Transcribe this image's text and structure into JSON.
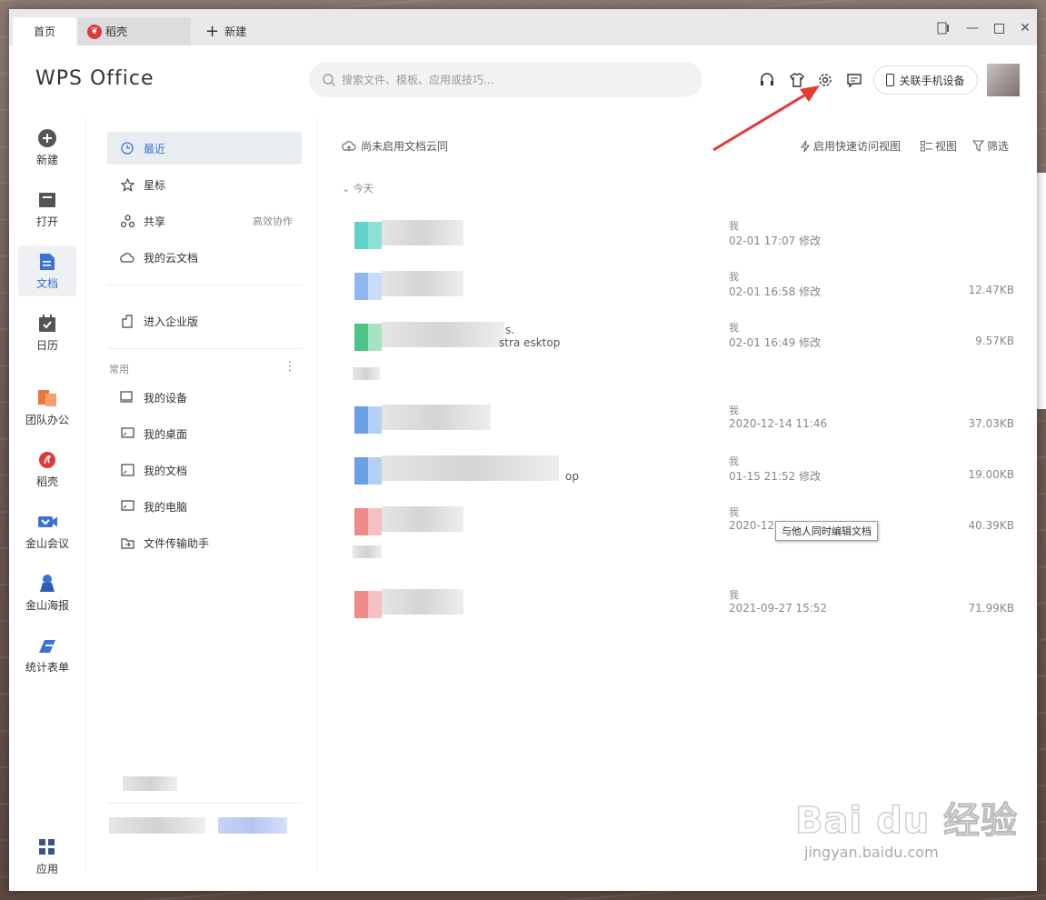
{
  "window": {
    "tabs": [
      {
        "label": "首页"
      },
      {
        "label": "稻壳"
      },
      {
        "label": "新建"
      }
    ]
  },
  "header": {
    "logo": "WPS Office",
    "search_placeholder": "搜索文件、模板、应用或技巧...",
    "phone_button": "关联手机设备"
  },
  "rail": {
    "items": [
      {
        "label": "新建",
        "icon": "plus-circle-icon"
      },
      {
        "label": "打开",
        "icon": "folder-icon"
      },
      {
        "label": "文档",
        "icon": "document-icon"
      },
      {
        "label": "日历",
        "icon": "calendar-icon"
      },
      {
        "label": "团队办公",
        "icon": "team-icon"
      },
      {
        "label": "稻壳",
        "icon": "docer-icon"
      },
      {
        "label": "金山会议",
        "icon": "meeting-icon"
      },
      {
        "label": "金山海报",
        "icon": "poster-icon"
      },
      {
        "label": "统计表单",
        "icon": "form-icon"
      },
      {
        "label": "应用",
        "icon": "apps-icon"
      }
    ]
  },
  "nav": {
    "recent": "最近",
    "starred": "星标",
    "shared": "共享",
    "shared_extra": "高效协作",
    "cloud": "我的云文档",
    "enterprise": "进入企业版",
    "section_common": "常用",
    "section_more": "⋮",
    "common_items": [
      {
        "label": "我的设备"
      },
      {
        "label": "我的桌面"
      },
      {
        "label": "我的文档"
      },
      {
        "label": "我的电脑"
      },
      {
        "label": "文件传输助手"
      }
    ]
  },
  "main": {
    "cloud_note": "尚未启用文档云同",
    "quick_access": "启用快速访问视图",
    "view": "视图",
    "filter": "筛选",
    "group_label": "今天",
    "files": [
      {
        "owner": "我",
        "time": "02-01 17:07 修改",
        "size": "",
        "name_fragment": "",
        "color": "#5fd3c7"
      },
      {
        "owner": "我",
        "time": "02-01 16:58 修改",
        "size": "12.47KB",
        "name_fragment": "",
        "color": "#8fb7f0"
      },
      {
        "owner": "我",
        "time": "02-01 16:49 修改",
        "size": "9.57KB",
        "name_fragment": "s.",
        "path_fragment": "stra   esktop",
        "color": "#4cc487"
      },
      {
        "owner": "我",
        "time": "2020-12-14 11:46",
        "size": "37.03KB",
        "name_fragment": "",
        "color": "#6b9fe6"
      },
      {
        "owner": "我",
        "time": "01-15 21:52 修改",
        "size": "19.00KB",
        "name_fragment": "",
        "path_fragment": "op",
        "color": "#6b9fe6"
      },
      {
        "owner": "我",
        "time": "2020-12-",
        "size": "40.39KB",
        "name_fragment": "",
        "color": "#ef8a8a"
      },
      {
        "owner": "我",
        "time": "2021-09-27 15:52",
        "size": "71.99KB",
        "name_fragment": "",
        "color": "#ef8a8a"
      }
    ],
    "tooltip": "与他人同时编辑文档"
  },
  "watermark": {
    "brand": "Bai du 经验",
    "url": "jingyan.baidu.com"
  }
}
